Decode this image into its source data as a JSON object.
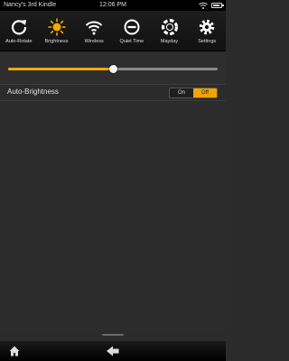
{
  "status_bar": {
    "device_name": "Nancy's 3rd Kindle",
    "time": "12:06 PM"
  },
  "quick_settings": [
    {
      "label": "Auto-Rotate",
      "icon": "auto-rotate-icon"
    },
    {
      "label": "Brightness",
      "icon": "brightness-icon"
    },
    {
      "label": "Wireless",
      "icon": "wireless-icon"
    },
    {
      "label": "Quiet Time",
      "icon": "quiet-time-icon"
    },
    {
      "label": "Mayday",
      "icon": "mayday-icon"
    },
    {
      "label": "Settings",
      "icon": "settings-icon"
    }
  ],
  "brightness": {
    "level": 0.5
  },
  "auto_brightness": {
    "label": "Auto-Brightness",
    "on_label": "On",
    "off_label": "Off",
    "selected": "Off"
  },
  "colors": {
    "accent": "#f2a900",
    "background": "#2b2b2b"
  },
  "nav": {
    "home_icon": "home-icon",
    "back_icon": "back-arrow-icon"
  }
}
